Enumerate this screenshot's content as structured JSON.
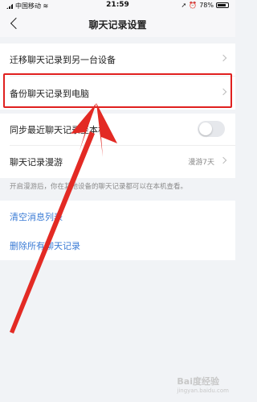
{
  "status": {
    "carrier": "中国移动",
    "time": "21:59",
    "battery": "78%"
  },
  "nav": {
    "title": "聊天记录设置"
  },
  "items": {
    "migrate": "迁移聊天记录到另一台设备",
    "backup": "备份聊天记录到电脑",
    "sync": "同步最近聊天记录至本机",
    "roaming": "聊天记录漫游",
    "roaming_value": "漫游7天",
    "roaming_hint": "开启漫游后，你在其他设备的聊天记录都可以在本机查看。",
    "clear_list": "清空消息列表",
    "delete_all": "删除所有聊天记录"
  },
  "toggle": {
    "sync_on": false
  },
  "colors": {
    "highlight": "#e0201f",
    "link": "#3a7bd5"
  },
  "watermark": {
    "brand": "Bai度经验",
    "sub": "jingyan.baidu.com"
  }
}
